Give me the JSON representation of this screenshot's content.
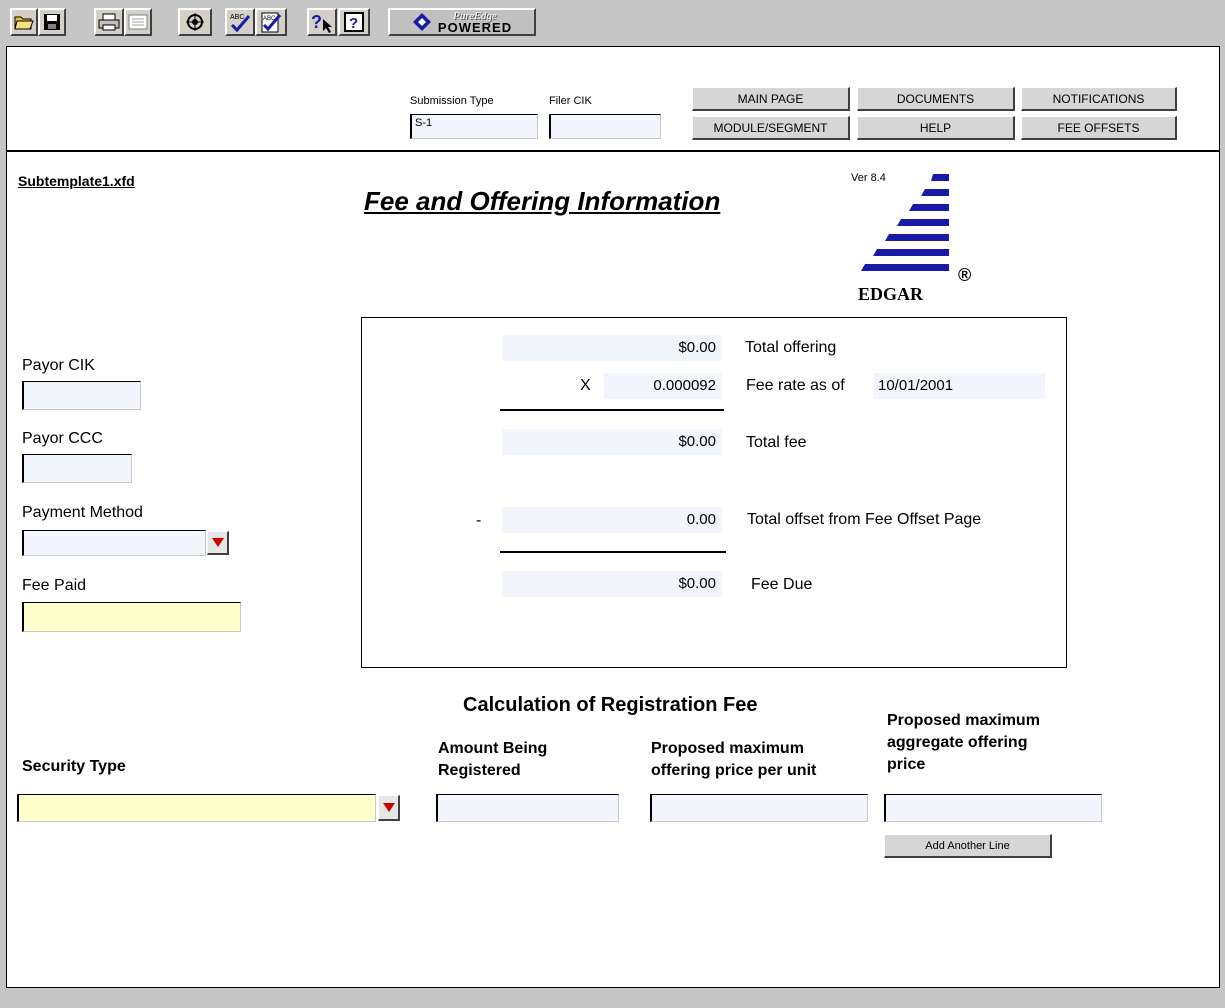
{
  "toolbar": {
    "buttons": [
      {
        "name": "open-icon"
      },
      {
        "name": "save-icon"
      },
      {
        "name": "print-icon"
      },
      {
        "name": "preview-icon"
      },
      {
        "name": "transmit-icon"
      },
      {
        "name": "spellcheck-icon"
      },
      {
        "name": "spellcheck-document-icon"
      },
      {
        "name": "context-help-icon"
      },
      {
        "name": "help-icon"
      }
    ],
    "logo_text_top": "PureEdge",
    "logo_text_bottom": "POWERED"
  },
  "header": {
    "submission_type_label": "Submission Type",
    "submission_type_value": "S-1",
    "filer_cik_label": "Filer CIK",
    "filer_cik_value": "",
    "nav": {
      "main_page": "MAIN PAGE",
      "documents": "DOCUMENTS",
      "notifications": "NOTIFICATIONS",
      "module_segment": "MODULE/SEGMENT",
      "help": "HELP",
      "fee_offsets": "FEE OFFSETS"
    }
  },
  "form": {
    "template_name": "Subtemplate1.xfd",
    "title": "Fee and Offering Information",
    "version": "Ver 8.4",
    "logo_text": "EDGAR",
    "logo_mark": "®"
  },
  "left_fields": {
    "payor_cik_label": "Payor CIK",
    "payor_cik_value": "",
    "payor_ccc_label": "Payor CCC",
    "payor_ccc_value": "",
    "payment_method_label": "Payment Method",
    "payment_method_value": "",
    "fee_paid_label": "Fee Paid",
    "fee_paid_value": ""
  },
  "fee_box": {
    "total_offering_value": "$0.00",
    "total_offering_label": "Total offering",
    "multiply_sign": "X",
    "fee_rate_value": "0.000092",
    "fee_rate_label": "Fee rate as of",
    "fee_rate_date": "10/01/2001",
    "total_fee_value": "$0.00",
    "total_fee_label": "Total fee",
    "minus_sign": "-",
    "total_offset_value": "0.00",
    "total_offset_label": "Total offset from Fee Offset Page",
    "fee_due_value": "$0.00",
    "fee_due_label": "Fee Due"
  },
  "registration": {
    "section_title": "Calculation of Registration Fee",
    "security_type_label": "Security Type",
    "security_type_value": "",
    "amount_label_1": "Amount Being",
    "amount_label_2": "Registered",
    "amount_value": "",
    "price_unit_label_1": "Proposed maximum",
    "price_unit_label_2": "offering price per unit",
    "price_unit_value": "",
    "aggregate_label_1": "Proposed maximum",
    "aggregate_label_2": "aggregate offering",
    "aggregate_label_3": "price",
    "aggregate_value": "",
    "add_line_button": "Add Another Line"
  },
  "colors": {
    "field_bg": "#f2f6fc",
    "required_field_bg": "#ffffcc",
    "edgar_blue": "#1a1aa8",
    "dropdown_arrow": "#cc0000"
  }
}
